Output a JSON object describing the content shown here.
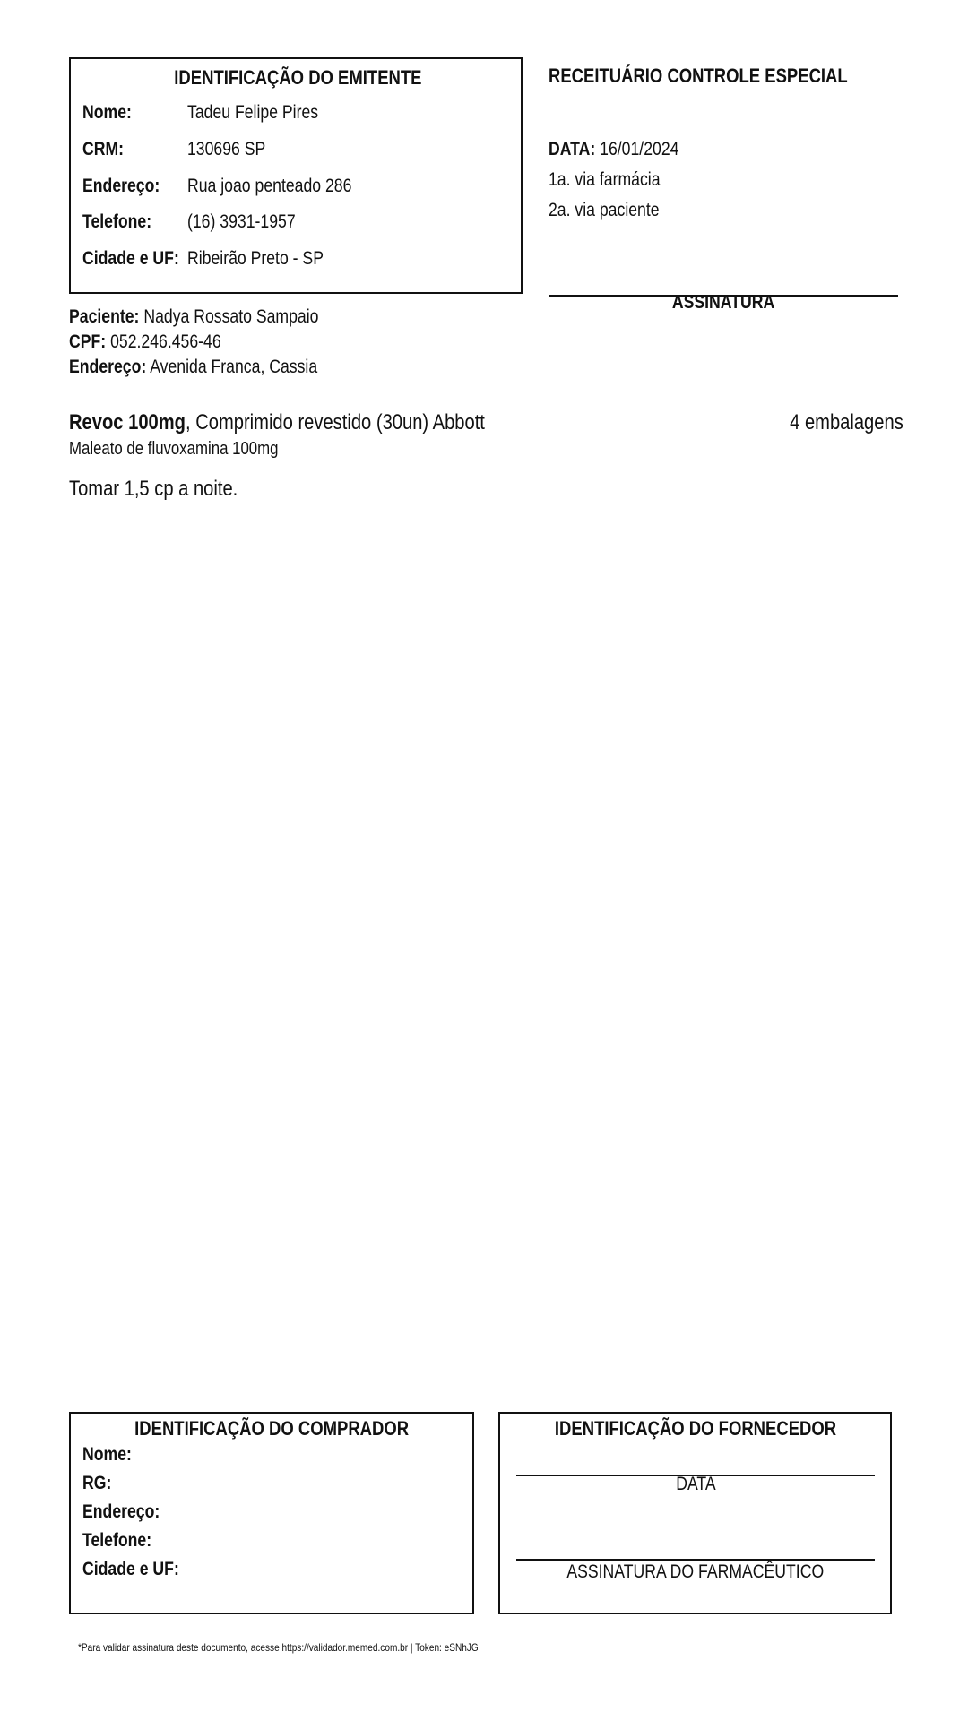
{
  "emitter": {
    "title": "IDENTIFICAÇÃO DO EMITENTE",
    "name_label": "Nome:",
    "name": "Tadeu Felipe Pires",
    "crm_label": "CRM:",
    "crm": "130696 SP",
    "address_label": "Endereço:",
    "address": "Rua joao penteado 286",
    "phone_label": "Telefone:",
    "phone": "(16) 3931-1957",
    "city_label": "Cidade e UF:",
    "city": "Ribeirão Preto - SP"
  },
  "prescription": {
    "title": "RECEITUÁRIO CONTROLE ESPECIAL",
    "date_label": "DATA:",
    "date": "16/01/2024",
    "via1": "1a. via farmácia",
    "via2": "2a. via paciente",
    "signature_label": "ASSINATURA"
  },
  "patient": {
    "name_label": "Paciente:",
    "name": "Nadya Rossato Sampaio",
    "cpf_label": "CPF:",
    "cpf": "052.246.456-46",
    "address_label": "Endereço:",
    "address": "Avenida Franca, Cassia"
  },
  "medication": {
    "name": "Revoc 100mg",
    "description": ", Comprimido revestido (30un) Abbott",
    "quantity": "4 embalagens",
    "substance": "Maleato de fluvoxamina 100mg",
    "instructions": "Tomar 1,5 cp a noite."
  },
  "buyer": {
    "title": "IDENTIFICAÇÃO DO COMPRADOR",
    "name_label": "Nome:",
    "rg_label": "RG:",
    "address_label": "Endereço:",
    "phone_label": "Telefone:",
    "city_label": "Cidade e UF:"
  },
  "supplier": {
    "title": "IDENTIFICAÇÃO DO FORNECEDOR",
    "date_label": "DATA",
    "pharmacist_signature_label": "ASSINATURA DO FARMACÊUTICO"
  },
  "footer": {
    "note": "*Para validar assinatura deste documento, acesse https://validador.memed.com.br | Token: eSNhJG"
  }
}
